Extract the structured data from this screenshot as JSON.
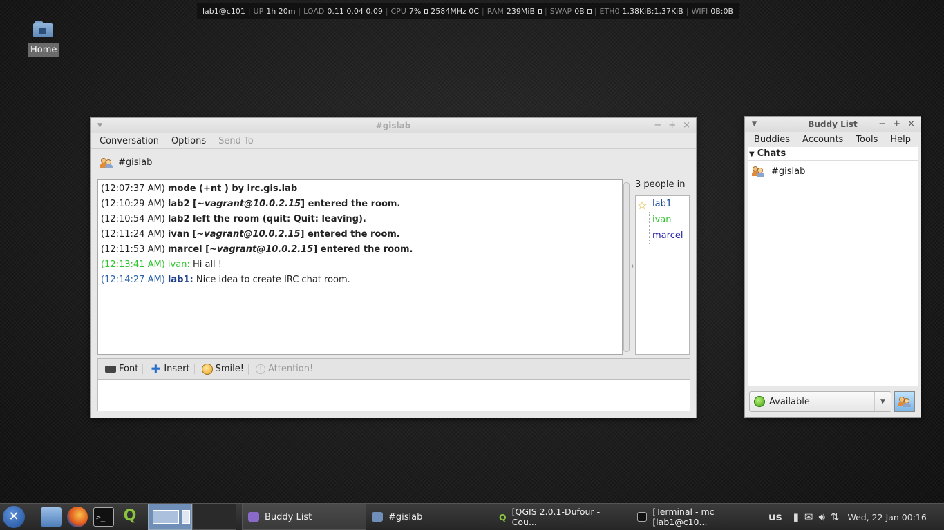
{
  "statusbar": {
    "host": "lab1@c101",
    "up_label": "UP",
    "up_value": "1h 20m",
    "load_label": "LOAD",
    "load_value": "0.11 0.04 0.09",
    "cpu_label": "CPU",
    "cpu_value": "7%",
    "cpu_freq": "2584MHz 0C",
    "cpu_fill": 0.07,
    "ram_label": "RAM",
    "ram_value": "239MiB",
    "ram_fill": 0.2,
    "swap_label": "SWAP",
    "swap_value": "0B",
    "swap_fill": 0.0,
    "eth_label": "ETH0",
    "eth_value": "1.38KiB:1.37KiB",
    "wifi_label": "WIFI",
    "wifi_value": "0B:0B"
  },
  "desktop": {
    "home_label": "Home"
  },
  "chat_window": {
    "title": "#gislab",
    "menu": [
      "Conversation",
      "Options",
      "Send To"
    ],
    "room_name": "#gislab",
    "people_count": "3 people in ...",
    "log": [
      {
        "ts": "(12:07:37 AM)",
        "text": "mode (+nt ) by irc.gis.lab",
        "kind": "sys"
      },
      {
        "ts": "(12:10:29 AM)",
        "pre": "lab2 [",
        "em": "~vagrant@10.0.2.15",
        "post": "] entered the room.",
        "kind": "sys-em"
      },
      {
        "ts": "(12:10:54 AM)",
        "text": "lab2 left the room (quit: Quit: leaving).",
        "kind": "sys"
      },
      {
        "ts": "(12:11:24 AM)",
        "pre": "ivan [",
        "em": "~vagrant@10.0.2.15",
        "post": "] entered the room.",
        "kind": "sys-em"
      },
      {
        "ts": "(12:11:53 AM)",
        "pre": "marcel [",
        "em": "~vagrant@10.0.2.15",
        "post": "] entered the room.",
        "kind": "sys-em"
      },
      {
        "ts": "(12:13:41 AM)",
        "nick": "ivan:",
        "msg": "Hi all !",
        "kind": "ivan"
      },
      {
        "ts": "(12:14:27 AM)",
        "nick": "lab1:",
        "msg": "Nice idea to create IRC chat room.",
        "kind": "lab1"
      }
    ],
    "people": [
      "lab1",
      "ivan",
      "marcel"
    ],
    "toolbar": {
      "font": "Font",
      "insert": "Insert",
      "smile": "Smile!",
      "attention": "Attention!"
    },
    "input_value": ""
  },
  "buddy_window": {
    "title": "Buddy List",
    "menu": [
      "Buddies",
      "Accounts",
      "Tools",
      "Help"
    ],
    "group": "Chats",
    "chat_entry": "#gislab",
    "status": "Available"
  },
  "taskbar": {
    "tasks": [
      {
        "label": "Buddy List"
      },
      {
        "label": "#gislab"
      },
      {
        "label": "[QGIS 2.0.1-Dufour - Cou..."
      },
      {
        "label": "[Terminal - mc [lab1@c10..."
      }
    ],
    "keyboard": "us",
    "clock": "Wed, 22 Jan  00:16"
  },
  "colors": {
    "ivan": "#2ec42e",
    "lab1": "#1f3f8a",
    "accent_blue": "#2a63a8"
  }
}
